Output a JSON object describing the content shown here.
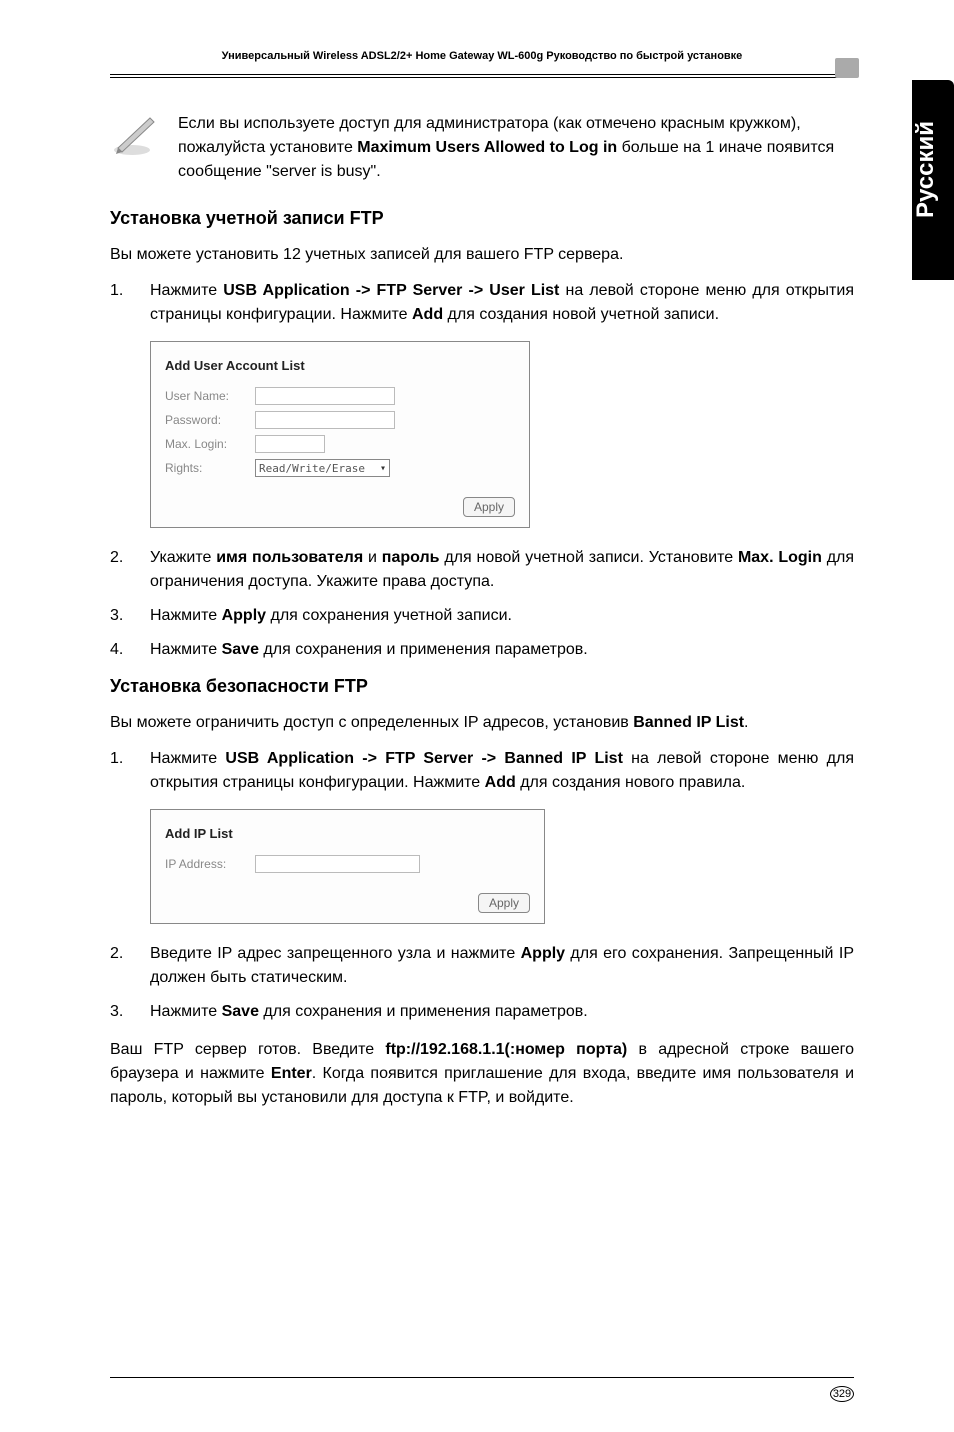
{
  "header": "Универсальный Wireless ADSL2/2+ Home Gateway  WL-600g Руководство по быстрой установке",
  "side_tab": "Русский",
  "note": {
    "text_parts": [
      "Если вы используете доступ для администратора (как отмечено красным кружком), пожалуйста установите ",
      "Maximum Users Allowed to Log in",
      " больше на 1 иначе появится сообщение \"server is busy\"."
    ]
  },
  "section1": {
    "heading": "Установка учетной записи FTP",
    "intro": "Вы можете установить 12 учетных записей для вашего FTP сервера.",
    "items": [
      {
        "num": "1.",
        "parts": [
          "Нажмите ",
          "USB Application -> FTP Server -> User List",
          " на левой стороне меню для открытия страницы конфигурации. Нажмите ",
          "Add",
          " для создания новой учетной записи."
        ]
      },
      {
        "num": "2.",
        "parts": [
          "Укажите ",
          "имя пользователя",
          " и ",
          "пароль",
          " для новой учетной записи. Установите ",
          "Max. Login",
          " для ограничения доступа. Укажите права доступа."
        ]
      },
      {
        "num": "3.",
        "parts": [
          "Нажмите ",
          "Apply",
          " для сохранения учетной записи."
        ]
      },
      {
        "num": "4.",
        "parts": [
          "Нажмите ",
          "Save",
          " для сохранения и применения параметров."
        ]
      }
    ],
    "screenshot": {
      "title": "Add User Account List",
      "labels": {
        "username": "User Name:",
        "password": "Password:",
        "maxlogin": "Max. Login:",
        "rights": "Rights:"
      },
      "rights_value": "Read/Write/Erase",
      "apply": "Apply"
    }
  },
  "section2": {
    "heading": "Установка безопасности FTP",
    "intro_parts": [
      "Вы можете ограничить доступ с определенных  IP адресов, установив ",
      "Banned IP List",
      "."
    ],
    "items": [
      {
        "num": "1.",
        "parts": [
          "Нажмите ",
          "USB Application -> FTP Server -> Banned IP List",
          " на левой стороне меню для открытия страницы конфигурации. Нажмите ",
          "Add",
          " для создания нового правила."
        ]
      },
      {
        "num": "2.",
        "parts": [
          "Введите IP адрес запрещенного узла и нажмите ",
          "Apply",
          " для его сохранения. Запрещенный IP должен быть статическим."
        ]
      },
      {
        "num": "3.",
        "parts": [
          "Нажмите ",
          "Save",
          " для сохранения и применения параметров."
        ]
      }
    ],
    "screenshot": {
      "title": "Add IP List",
      "labels": {
        "ip": "IP Address:"
      },
      "apply": "Apply"
    },
    "closing_parts": [
      "Ваш FTP сервер готов. Введите ",
      "ftp://192.168.1.1(:номер порта)",
      " в адресной строке вашего браузера и нажмите ",
      "Enter",
      ". Когда появится приглашение для входа, введите имя пользователя и пароль, который вы установили для доступа к FTP, и войдите."
    ]
  },
  "page_number": "329"
}
